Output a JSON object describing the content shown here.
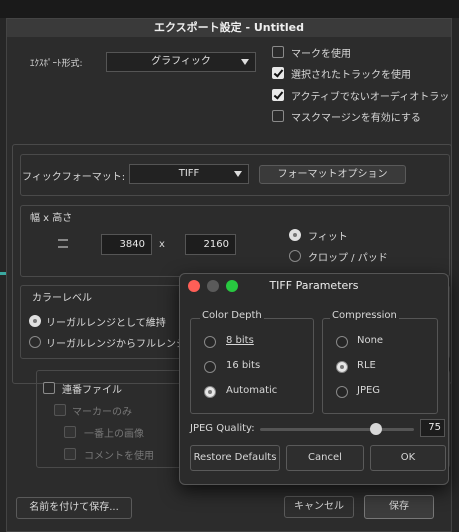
{
  "main_window": {
    "title": "エクスポート設定 - Untitled",
    "export_format_label": "ｴｸｽﾎﾟｰﾄ形式:",
    "export_format_value": "グラフィック",
    "options": [
      {
        "label": "マークを使用",
        "checked": false
      },
      {
        "label": "選択されたトラックを使用",
        "checked": true
      },
      {
        "label": "アクティブでないオーディオトラッ",
        "checked": true
      },
      {
        "label": "マスクマージンを有効にする",
        "checked": false
      }
    ],
    "graphic_format_label": "フィックフォーマット:",
    "graphic_format_value": "TIFF",
    "format_options_button": "フォーマットオプション",
    "size_section_title": "幅 x 高さ",
    "width_value": "3840",
    "x_separator": "x",
    "height_value": "2160",
    "fit_options": [
      {
        "label": "フィット",
        "selected": true
      },
      {
        "label": "クロップ / パッド",
        "selected": false
      }
    ],
    "color_level_title": "カラーレベル",
    "color_level_options": [
      {
        "label": "リーガルレンジとして維持",
        "selected": true
      },
      {
        "label": "リーガルレンジからフルレンジ",
        "selected": false
      }
    ],
    "sequence_file_label": "連番ファイル",
    "sequence_sub_options": [
      "マーカーのみ",
      "一番上の画像",
      "コメントを使用"
    ],
    "save_as_button": "名前を付けて保存...",
    "cancel_button": "キャンセル",
    "save_button": "保存"
  },
  "tiff_dialog": {
    "title": "TIFF Parameters",
    "color_depth_title": "Color Depth",
    "color_depth_options": [
      {
        "label": "8 bits",
        "selected": false
      },
      {
        "label": "16 bits",
        "selected": false
      },
      {
        "label": "Automatic",
        "selected": true
      }
    ],
    "compression_title": "Compression",
    "compression_options": [
      {
        "label": "None",
        "selected": false
      },
      {
        "label": "RLE",
        "selected": true
      },
      {
        "label": "JPEG",
        "selected": false
      }
    ],
    "jpeg_quality_label": "JPEG Quality:",
    "jpeg_quality_value": "75",
    "jpeg_quality_fraction": 0.75,
    "restore_defaults_button": "Restore Defaults",
    "cancel_button": "Cancel",
    "ok_button": "OK",
    "traffic_light_colors": [
      "#ff5f57",
      "#5a5a5a",
      "#28c840"
    ]
  }
}
